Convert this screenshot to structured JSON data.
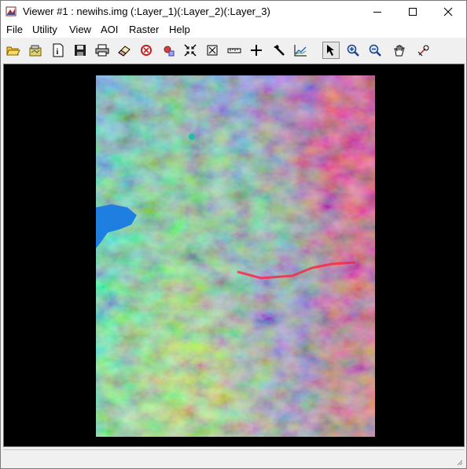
{
  "window": {
    "title": "Viewer #1 : newihs.img (:Layer_1)(:Layer_2)(:Layer_3)",
    "controls": {
      "minimize": "minimize-icon",
      "maximize": "maximize-icon",
      "close": "close-icon"
    }
  },
  "menu": {
    "items": [
      {
        "label": "File"
      },
      {
        "label": "Utility"
      },
      {
        "label": "View"
      },
      {
        "label": "AOI"
      },
      {
        "label": "Raster"
      },
      {
        "label": "Help"
      }
    ]
  },
  "toolbar": {
    "tools": [
      "open-folder-icon",
      "open-layer-icon",
      "info-icon",
      "save-icon",
      "print-icon",
      "eraser-icon",
      "clear-icon",
      "layer-info-icon",
      "zoom-in-fit-icon",
      "zoom-extent-icon",
      "measure-icon",
      "inquire-cursor-icon",
      "pick-icon",
      "profile-icon",
      "select-arrow-icon",
      "zoom-in-icon",
      "zoom-out-icon",
      "pan-hand-icon",
      "rotate-icon"
    ],
    "active_tool": "select-arrow-icon"
  },
  "viewer": {
    "background_color": "#000000",
    "image": "false-color-raster-image"
  },
  "colors": {
    "title_bar": "#ffffff",
    "toolbar": "#f0f0f0",
    "viewer_bg": "#000000"
  }
}
